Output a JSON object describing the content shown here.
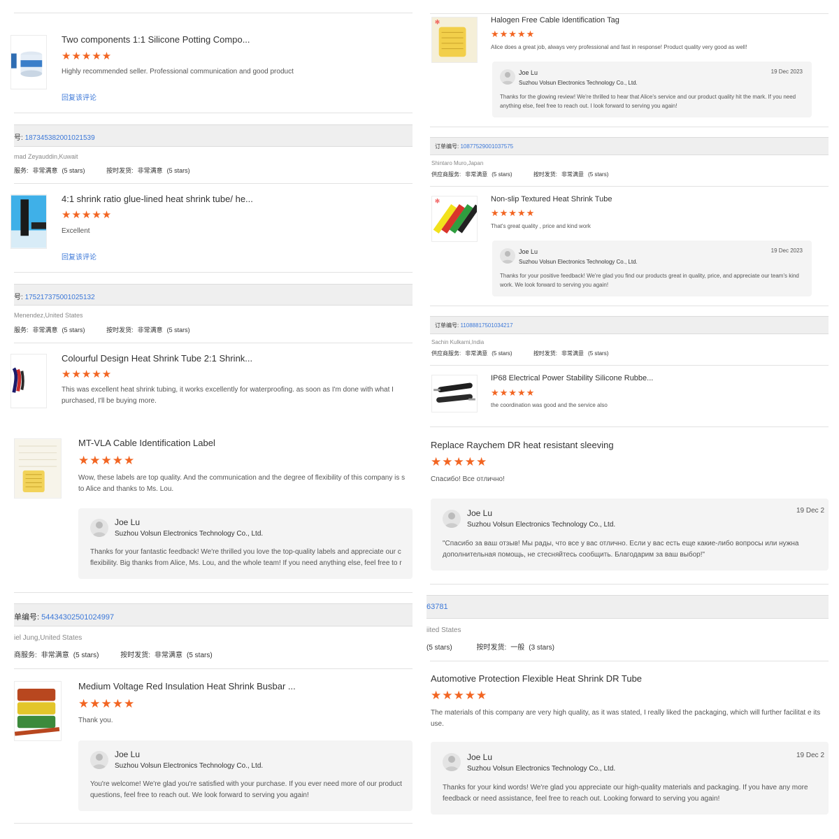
{
  "colors": {
    "accent_star": "#f26522",
    "link": "#3c78d8",
    "order_bar": "#efefef"
  },
  "left": {
    "review1": {
      "title": "Two components 1:1 Silicone Potting Compo...",
      "stars": "★★★★★",
      "text": "Highly recommended seller. Professional communication and good product",
      "reply_link": "回复该评论",
      "thumb_icon": "potting-jar-icon"
    },
    "order1": {
      "label": "号:",
      "number": "187345382001021539",
      "buyer": "mad Zeyauddin,Kuwait",
      "svc_label": "服务:",
      "svc_value": "非常满意",
      "svc_stars": "(5 stars)",
      "ship_label": "按时发货:",
      "ship_value": "非常满意",
      "ship_stars": "(5 stars)"
    },
    "review2": {
      "title": "4:1 shrink ratio glue-lined heat shrink tube/ he...",
      "stars": "★★★★★",
      "text": "Excellent",
      "reply_link": "回复该评论",
      "thumb_icon": "heat-shrink-tube-icon"
    },
    "order2": {
      "label": "号:",
      "number": "175217375001025132",
      "buyer": "Menendez,United States",
      "svc_label": "服务:",
      "svc_value": "非常满意",
      "svc_stars": "(5 stars)",
      "ship_label": "按时发货:",
      "ship_value": "非常满意",
      "ship_stars": "(5 stars)"
    },
    "review3": {
      "title": "Colourful Design Heat Shrink Tube 2:1 Shrink...",
      "stars": "★★★★★",
      "text": "This was excellent heat shrink tubing, it works excellently for waterproofing. as soon as I'm done with what I purchased, I'll be buying more.",
      "thumb_icon": "coloured-tube-icon"
    },
    "review4": {
      "title": "MT-VLA Cable Identification Label",
      "stars": "★★★★★",
      "text": "Wow, these labels are top quality. And the communication and the degree of flexibility of this company is s to Alice and thanks to Ms. Lou.",
      "thumb_icon": "cable-label-icon",
      "reply": {
        "name": "Joe Lu",
        "company": "Suzhou Volsun Electronics Technology Co., Ltd.",
        "body": "Thanks for your fantastic feedback! We're thrilled you love the top-quality labels and appreciate our c flexibility. Big thanks from Alice, Ms. Lou, and the whole team! If you need anything else, feel free to r"
      }
    },
    "order3": {
      "label": "单编号:",
      "number": "544343025010249​97",
      "buyer": "iel Jung,United States",
      "svc_label": "商服务:",
      "svc_value": "非常满意",
      "svc_stars": "(5 stars)",
      "ship_label": "按时发货:",
      "ship_value": "非常满意",
      "ship_stars": "(5 stars)"
    },
    "review5": {
      "title": "Medium Voltage Red Insulation Heat Shrink Busbar ...",
      "stars": "★★★★★",
      "text": "Thank you.",
      "thumb_icon": "busbar-tube-icon",
      "reply": {
        "name": "Joe Lu",
        "company": "Suzhou Volsun Electronics Technology Co., Ltd.",
        "body": "You're welcome! We're glad you're satisfied with your purchase. If you ever need more of our product questions, feel free to reach out. We look forward to serving you again!"
      }
    }
  },
  "right": {
    "review1": {
      "title": "Halogen Free Cable Identification Tag",
      "stars": "★★★★★",
      "text": "Alice does a great job, always very professional and fast in response! Product quality very good as well!",
      "thumb_icon": "identification-tag-icon",
      "reply": {
        "name": "Joe Lu",
        "company": "Suzhou Volsun Electronics Technology Co., Ltd.",
        "date": "19 Dec 2023",
        "body": "Thanks for the glowing review! We're thrilled to hear that Alice's service and our product quality hit the mark. If you need anything else, feel free to reach out. I look forward to serving you again!"
      }
    },
    "order1": {
      "label": "订单编号:",
      "number": "108775290010375​75",
      "buyer": "Shintaro Muro,Japan",
      "svc_label": "供应商服务:",
      "svc_value": "非常满意",
      "svc_stars": "(5 stars)",
      "ship_label": "按时发货:",
      "ship_value": "非常满意",
      "ship_stars": "(5 stars)"
    },
    "review2": {
      "title": "Non-slip Textured Heat Shrink Tube",
      "stars": "★★★★★",
      "text": "That's great quality , price and kind work",
      "thumb_icon": "textured-tube-icon",
      "reply": {
        "name": "Joe Lu",
        "company": "Suzhou Volsun Electronics Technology Co., Ltd.",
        "date": "19 Dec 2023",
        "body": "Thanks for your positive feedback! We're glad you find our products great in quality, price, and appreciate our team's kind work. We look forward to serving you again!"
      }
    },
    "order2": {
      "label": "订单编号:",
      "number": "110888175010342​17",
      "buyer": "Sachin Kulkarni,India",
      "svc_label": "供应商服务:",
      "svc_value": "非常满意",
      "svc_stars": "(5 stars)",
      "ship_label": "按时发货:",
      "ship_value": "非常满意",
      "ship_stars": "(5 stars)"
    },
    "review3": {
      "title": "IP68 Electrical Power Stability Silicone Rubbe...",
      "stars": "★★★★★",
      "text": "the coordination was good and the service also",
      "thumb_icon": "silicone-rubber-tube-icon"
    },
    "review4": {
      "title": "Replace Raychem DR heat resistant sleeving",
      "stars": "★★★★★",
      "text": "Спасибо! Все отлично!",
      "reply": {
        "name": "Joe Lu",
        "company": "Suzhou Volsun Electronics Technology Co., Ltd.",
        "date": "19 Dec 2",
        "body": "\"Спасибо за ваш отзыв! Мы рады, что все у вас отлично. Если у вас есть еще какие-либо вопросы или нужна дополнительная помощь, не стесняйтесь сообщить. Благодарим за ваш выбор!\""
      }
    },
    "order3": {
      "number": "63781",
      "buyer": "iited States",
      "svc_stars": "(5 stars)",
      "ship_label": "按时发货:",
      "ship_value": "一般",
      "ship_stars": "(3 stars)"
    },
    "review5": {
      "title": "Automotive Protection Flexible Heat Shrink DR Tube",
      "stars": "★★★★★",
      "text": "The materials of this company are very high quality, as it was stated, I really liked the packaging, which will further facilitat e its use.",
      "reply": {
        "name": "Joe Lu",
        "company": "Suzhou Volsun Electronics Technology Co., Ltd.",
        "date": "19 Dec 2",
        "body": "Thanks for your kind words! We're glad you appreciate our high-quality materials and packaging. If you have any more feedback or need assistance, feel free to reach out. Looking forward to serving you again!"
      }
    }
  }
}
